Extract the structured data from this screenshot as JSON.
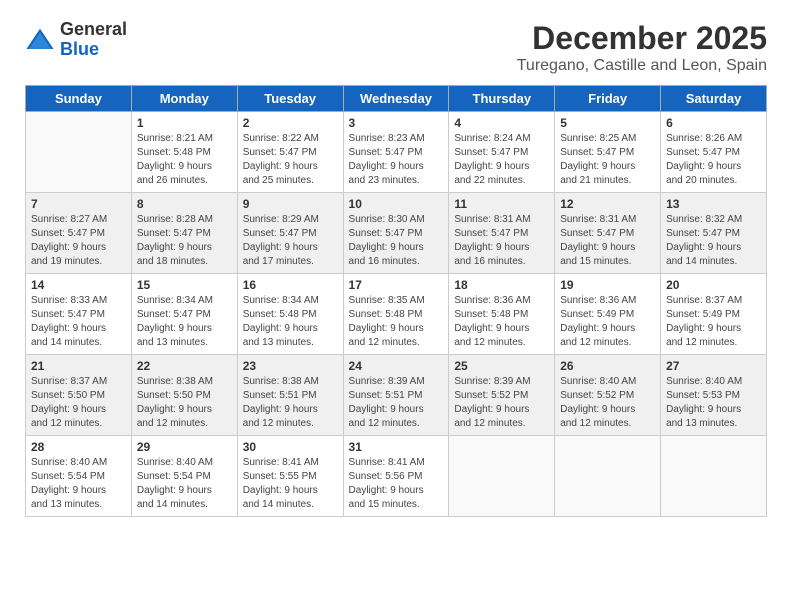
{
  "logo": {
    "general": "General",
    "blue": "Blue"
  },
  "title": "December 2025",
  "subtitle": "Turegano, Castille and Leon, Spain",
  "headers": [
    "Sunday",
    "Monday",
    "Tuesday",
    "Wednesday",
    "Thursday",
    "Friday",
    "Saturday"
  ],
  "weeks": [
    [
      {
        "day": "",
        "content": "",
        "empty": true
      },
      {
        "day": "1",
        "content": "Sunrise: 8:21 AM\nSunset: 5:48 PM\nDaylight: 9 hours\nand 26 minutes."
      },
      {
        "day": "2",
        "content": "Sunrise: 8:22 AM\nSunset: 5:47 PM\nDaylight: 9 hours\nand 25 minutes."
      },
      {
        "day": "3",
        "content": "Sunrise: 8:23 AM\nSunset: 5:47 PM\nDaylight: 9 hours\nand 23 minutes."
      },
      {
        "day": "4",
        "content": "Sunrise: 8:24 AM\nSunset: 5:47 PM\nDaylight: 9 hours\nand 22 minutes."
      },
      {
        "day": "5",
        "content": "Sunrise: 8:25 AM\nSunset: 5:47 PM\nDaylight: 9 hours\nand 21 minutes."
      },
      {
        "day": "6",
        "content": "Sunrise: 8:26 AM\nSunset: 5:47 PM\nDaylight: 9 hours\nand 20 minutes."
      }
    ],
    [
      {
        "day": "7",
        "content": "Sunrise: 8:27 AM\nSunset: 5:47 PM\nDaylight: 9 hours\nand 19 minutes.",
        "shaded": true
      },
      {
        "day": "8",
        "content": "Sunrise: 8:28 AM\nSunset: 5:47 PM\nDaylight: 9 hours\nand 18 minutes.",
        "shaded": true
      },
      {
        "day": "9",
        "content": "Sunrise: 8:29 AM\nSunset: 5:47 PM\nDaylight: 9 hours\nand 17 minutes.",
        "shaded": true
      },
      {
        "day": "10",
        "content": "Sunrise: 8:30 AM\nSunset: 5:47 PM\nDaylight: 9 hours\nand 16 minutes.",
        "shaded": true
      },
      {
        "day": "11",
        "content": "Sunrise: 8:31 AM\nSunset: 5:47 PM\nDaylight: 9 hours\nand 16 minutes.",
        "shaded": true
      },
      {
        "day": "12",
        "content": "Sunrise: 8:31 AM\nSunset: 5:47 PM\nDaylight: 9 hours\nand 15 minutes.",
        "shaded": true
      },
      {
        "day": "13",
        "content": "Sunrise: 8:32 AM\nSunset: 5:47 PM\nDaylight: 9 hours\nand 14 minutes.",
        "shaded": true
      }
    ],
    [
      {
        "day": "14",
        "content": "Sunrise: 8:33 AM\nSunset: 5:47 PM\nDaylight: 9 hours\nand 14 minutes."
      },
      {
        "day": "15",
        "content": "Sunrise: 8:34 AM\nSunset: 5:47 PM\nDaylight: 9 hours\nand 13 minutes."
      },
      {
        "day": "16",
        "content": "Sunrise: 8:34 AM\nSunset: 5:48 PM\nDaylight: 9 hours\nand 13 minutes."
      },
      {
        "day": "17",
        "content": "Sunrise: 8:35 AM\nSunset: 5:48 PM\nDaylight: 9 hours\nand 12 minutes."
      },
      {
        "day": "18",
        "content": "Sunrise: 8:36 AM\nSunset: 5:48 PM\nDaylight: 9 hours\nand 12 minutes."
      },
      {
        "day": "19",
        "content": "Sunrise: 8:36 AM\nSunset: 5:49 PM\nDaylight: 9 hours\nand 12 minutes."
      },
      {
        "day": "20",
        "content": "Sunrise: 8:37 AM\nSunset: 5:49 PM\nDaylight: 9 hours\nand 12 minutes."
      }
    ],
    [
      {
        "day": "21",
        "content": "Sunrise: 8:37 AM\nSunset: 5:50 PM\nDaylight: 9 hours\nand 12 minutes.",
        "shaded": true
      },
      {
        "day": "22",
        "content": "Sunrise: 8:38 AM\nSunset: 5:50 PM\nDaylight: 9 hours\nand 12 minutes.",
        "shaded": true
      },
      {
        "day": "23",
        "content": "Sunrise: 8:38 AM\nSunset: 5:51 PM\nDaylight: 9 hours\nand 12 minutes.",
        "shaded": true
      },
      {
        "day": "24",
        "content": "Sunrise: 8:39 AM\nSunset: 5:51 PM\nDaylight: 9 hours\nand 12 minutes.",
        "shaded": true
      },
      {
        "day": "25",
        "content": "Sunrise: 8:39 AM\nSunset: 5:52 PM\nDaylight: 9 hours\nand 12 minutes.",
        "shaded": true
      },
      {
        "day": "26",
        "content": "Sunrise: 8:40 AM\nSunset: 5:52 PM\nDaylight: 9 hours\nand 12 minutes.",
        "shaded": true
      },
      {
        "day": "27",
        "content": "Sunrise: 8:40 AM\nSunset: 5:53 PM\nDaylight: 9 hours\nand 13 minutes.",
        "shaded": true
      }
    ],
    [
      {
        "day": "28",
        "content": "Sunrise: 8:40 AM\nSunset: 5:54 PM\nDaylight: 9 hours\nand 13 minutes."
      },
      {
        "day": "29",
        "content": "Sunrise: 8:40 AM\nSunset: 5:54 PM\nDaylight: 9 hours\nand 14 minutes."
      },
      {
        "day": "30",
        "content": "Sunrise: 8:41 AM\nSunset: 5:55 PM\nDaylight: 9 hours\nand 14 minutes."
      },
      {
        "day": "31",
        "content": "Sunrise: 8:41 AM\nSunset: 5:56 PM\nDaylight: 9 hours\nand 15 minutes."
      },
      {
        "day": "",
        "content": "",
        "empty": true
      },
      {
        "day": "",
        "content": "",
        "empty": true
      },
      {
        "day": "",
        "content": "",
        "empty": true
      }
    ]
  ]
}
